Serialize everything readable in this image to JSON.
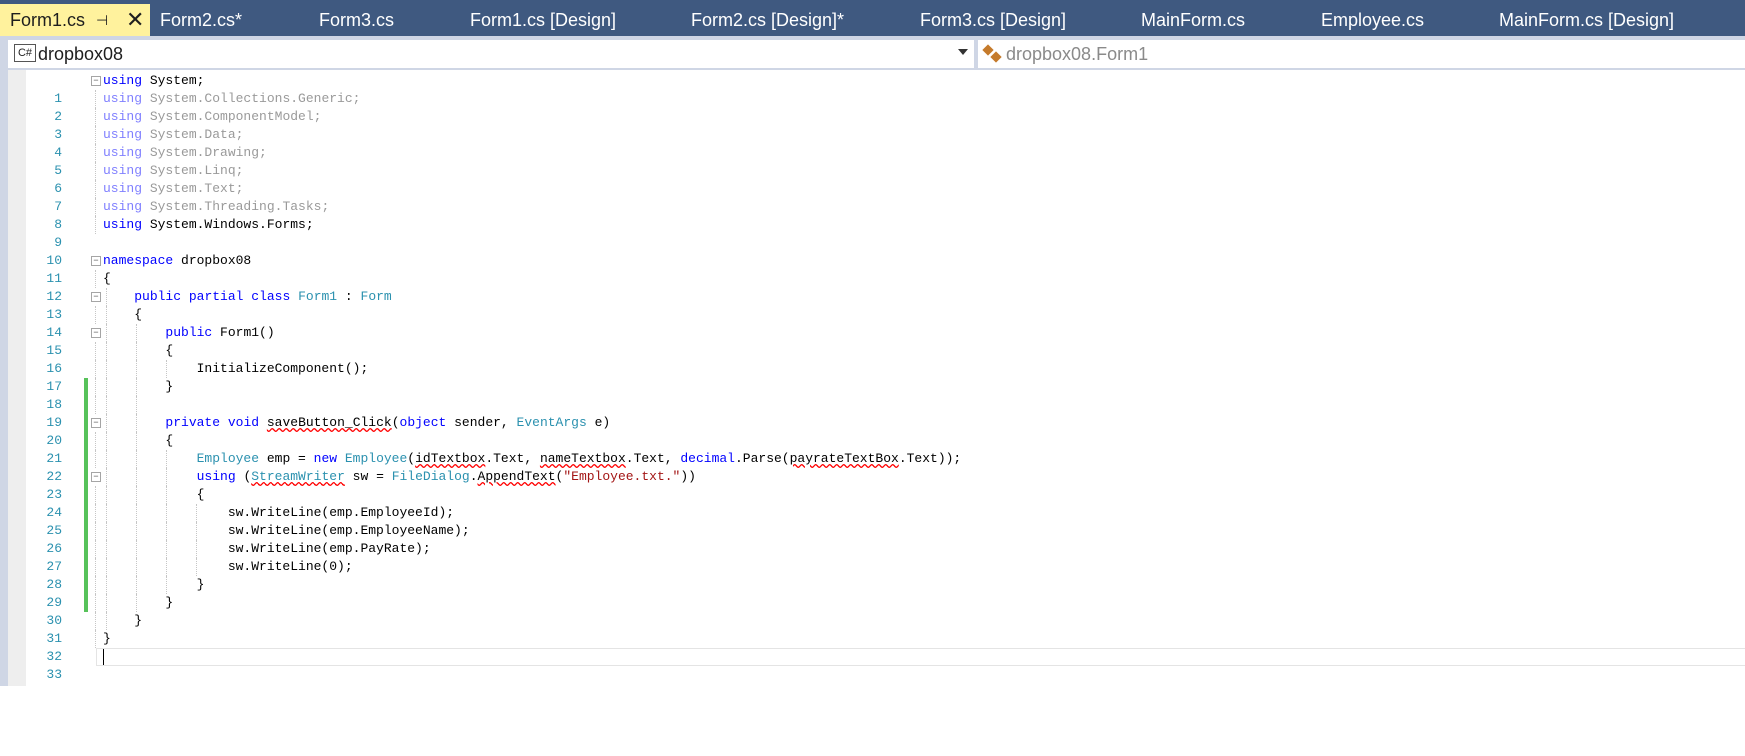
{
  "tabs": [
    {
      "label": "Form1.cs",
      "active": true
    },
    {
      "label": "Form2.cs*"
    },
    {
      "label": "Form3.cs"
    },
    {
      "label": "Form1.cs [Design]"
    },
    {
      "label": "Form2.cs [Design]*"
    },
    {
      "label": "Form3.cs [Design]"
    },
    {
      "label": "MainForm.cs"
    },
    {
      "label": "Employee.cs"
    },
    {
      "label": "MainForm.cs [Design]"
    }
  ],
  "nav": {
    "project": "dropbox08",
    "project_icon": "C#",
    "type_member": "dropbox08.Form1"
  },
  "colors": {
    "tab_bar": "#3f5980",
    "active_tab": "#fff29d",
    "keyword": "#0000ff",
    "type": "#2b91af",
    "string": "#a31515",
    "change_marker": "#57c25a",
    "line_number": "#2b91af"
  },
  "code": {
    "lines": [
      {
        "n": "1",
        "text": "using System;"
      },
      {
        "n": "2",
        "text": "using System.Collections.Generic;"
      },
      {
        "n": "3",
        "text": "using System.ComponentModel;"
      },
      {
        "n": "4",
        "text": "using System.Data;"
      },
      {
        "n": "5",
        "text": "using System.Drawing;"
      },
      {
        "n": "6",
        "text": "using System.Linq;"
      },
      {
        "n": "7",
        "text": "using System.Text;"
      },
      {
        "n": "8",
        "text": "using System.Threading.Tasks;"
      },
      {
        "n": "9",
        "text": "using System.Windows.Forms;"
      },
      {
        "n": "10",
        "text": ""
      },
      {
        "n": "11",
        "text": "namespace dropbox08"
      },
      {
        "n": "12",
        "text": "{"
      },
      {
        "n": "13",
        "text": "    public partial class Form1 : Form"
      },
      {
        "n": "14",
        "text": "    {"
      },
      {
        "n": "15",
        "text": "        public Form1()"
      },
      {
        "n": "16",
        "text": "        {"
      },
      {
        "n": "17",
        "text": "            InitializeComponent();"
      },
      {
        "n": "18",
        "text": "        }"
      },
      {
        "n": "19",
        "text": ""
      },
      {
        "n": "20",
        "text": "        private void saveButton_Click(object sender, EventArgs e)"
      },
      {
        "n": "21",
        "text": "        {"
      },
      {
        "n": "22",
        "text": "            Employee emp = new Employee(idTextbox.Text, nameTextbox.Text, decimal.Parse(payrateTextBox.Text));"
      },
      {
        "n": "23",
        "text": "            using (StreamWriter sw = FileDialog.AppendText(\"Employee.txt.\"))"
      },
      {
        "n": "24",
        "text": "            {"
      },
      {
        "n": "25",
        "text": "                sw.WriteLine(emp.EmployeeId);"
      },
      {
        "n": "26",
        "text": "                sw.WriteLine(emp.EmployeeName);"
      },
      {
        "n": "27",
        "text": "                sw.WriteLine(emp.PayRate);"
      },
      {
        "n": "28",
        "text": "                sw.WriteLine(0);"
      },
      {
        "n": "29",
        "text": "            }"
      },
      {
        "n": "30",
        "text": "        }"
      },
      {
        "n": "31",
        "text": "    }"
      },
      {
        "n": "32",
        "text": "}"
      },
      {
        "n": "33",
        "text": ""
      }
    ]
  }
}
